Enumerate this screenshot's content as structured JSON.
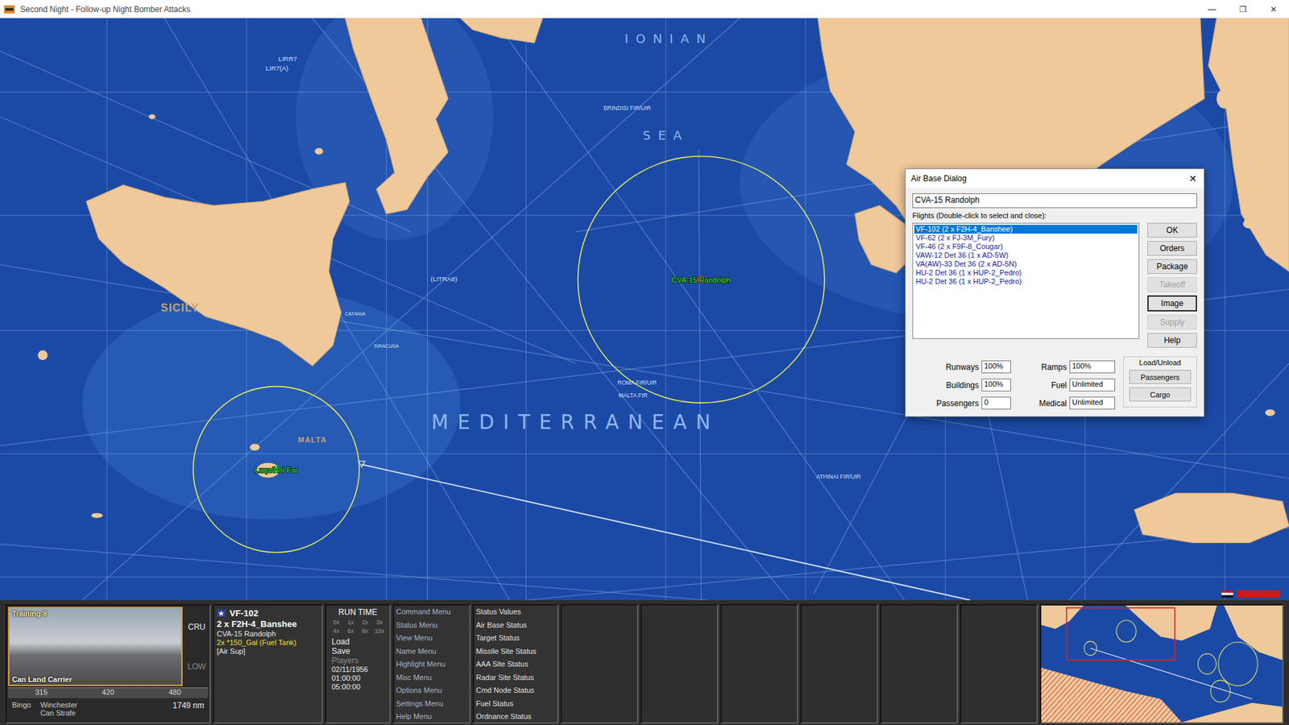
{
  "window": {
    "title": "Second Night - Follow-up Night Bomber Attacks",
    "controls": [
      "—",
      "❐",
      "✕"
    ]
  },
  "map": {
    "labels": [
      {
        "text": "IONIAN",
        "kind": "sea"
      },
      {
        "text": "SEA",
        "kind": "sea"
      },
      {
        "text": "MEDITERRANEAN",
        "kind": "sea"
      },
      {
        "text": "SICILY",
        "kind": "region"
      },
      {
        "text": "MALTA",
        "kind": "region"
      },
      {
        "text": "(LITRA8)",
        "kind": "fir"
      },
      {
        "text": "BRINDISI FIR/UIR",
        "kind": "fir"
      },
      {
        "text": "ROMA FIR/UIR",
        "kind": "fir"
      },
      {
        "text": "MALTA FIR",
        "kind": "fir"
      },
      {
        "text": "LIRR7",
        "kind": "fir"
      },
      {
        "text": "LIR7(A)",
        "kind": "fir"
      },
      {
        "text": "CATANIA",
        "kind": "fir"
      },
      {
        "text": "SIRACUSA",
        "kind": "fir"
      },
      {
        "text": "ATHINAI FIR/UIR",
        "kind": "fir"
      }
    ],
    "units": [
      {
        "name": "CVA-15 Randolph",
        "selected": true
      },
      {
        "name": "Luqa/Hal Far",
        "selected": false
      }
    ]
  },
  "dialog": {
    "title": "Air Base Dialog",
    "close": "✕",
    "base": "CVA-15 Randolph",
    "list_label": "Flights (Double-click to select and close):",
    "flights": [
      {
        "label": "VF-102 (2 x F2H-4_Banshee)",
        "selected": true
      },
      {
        "label": "VF-62 (2 x FJ-3M_Fury)",
        "selected": false
      },
      {
        "label": "VF-46 (2 x F9F-8_Cougar)",
        "selected": false
      },
      {
        "label": "VAW-12 Det 36 (1 x AD-5W)",
        "selected": false
      },
      {
        "label": "VA(AW)-33 Det 36 (2 x AD-5N)",
        "selected": false
      },
      {
        "label": "HU-2 Det 36 (1 x HUP-2_Pedro)",
        "selected": false
      },
      {
        "label": "HU-2 Det 36 (1 x HUP-2_Pedro)",
        "selected": false
      }
    ],
    "buttons": [
      {
        "label": "OK",
        "disabled": false,
        "default": false
      },
      {
        "label": "Orders",
        "disabled": false,
        "default": false
      },
      {
        "label": "Package",
        "disabled": false,
        "default": false
      },
      {
        "label": "Takeoff",
        "disabled": true,
        "default": false
      },
      {
        "label": "Image",
        "disabled": false,
        "default": true
      },
      {
        "label": "Supply",
        "disabled": true,
        "default": false
      },
      {
        "label": "Help",
        "disabled": false,
        "default": false
      }
    ],
    "fields": [
      {
        "label": "Runways",
        "value": "100%"
      },
      {
        "label": "Ramps",
        "value": "100%"
      },
      {
        "label": "Buildings",
        "value": "100%"
      },
      {
        "label": "Fuel",
        "value": "Unlimited"
      },
      {
        "label": "Passengers",
        "value": "0"
      },
      {
        "label": "Medical",
        "value": "Unlimited"
      }
    ],
    "load_unload": {
      "title": "Load/Unload",
      "buttons": [
        "Passengers",
        "Cargo"
      ]
    }
  },
  "bottom": {
    "portrait": {
      "caption_top": "Training 8",
      "caption_bottom": "Can Land Carrier"
    },
    "altitude": [
      {
        "label": "CRU",
        "selected": true
      },
      {
        "label": "LOW",
        "selected": false
      }
    ],
    "speeds": [
      "315",
      "420",
      "480"
    ],
    "flags": [
      "Bingo",
      "Winchester",
      "Can Strafe"
    ],
    "range": "1749 nm",
    "unit": {
      "name": "VF-102",
      "aircraft": "2 x F2H-4_Banshee",
      "base": "CVA-15 Randolph",
      "loadout": "2x *150_Gal (Fuel Tank)",
      "mission": "[Air Sup]"
    },
    "run": {
      "title": "RUN TIME",
      "speeds": [
        "0x",
        "1x",
        "2x",
        "3x",
        "4x",
        "6x",
        "8x",
        "10x"
      ],
      "buttons": [
        {
          "label": "Load",
          "disabled": false
        },
        {
          "label": "Save",
          "disabled": false
        },
        {
          "label": "Players",
          "disabled": true
        }
      ],
      "date": "02/11/1956",
      "time": "01:00:00",
      "end": "05:00:00"
    },
    "menus": [
      "Command Menu",
      "Status Menu",
      "View Menu",
      "Name Menu",
      "Highlight Menu",
      "Misc Menu",
      "Options Menu",
      "Settings Menu",
      "Help Menu"
    ],
    "status_menus": [
      "Status Values",
      "Air Base Status",
      "Target Status",
      "Missile Site Status",
      "AAA Site Status",
      "Radar Site Status",
      "Cmd Node Status",
      "Fuel Status",
      "Ordnance Status"
    ],
    "empty_slots": 6
  }
}
